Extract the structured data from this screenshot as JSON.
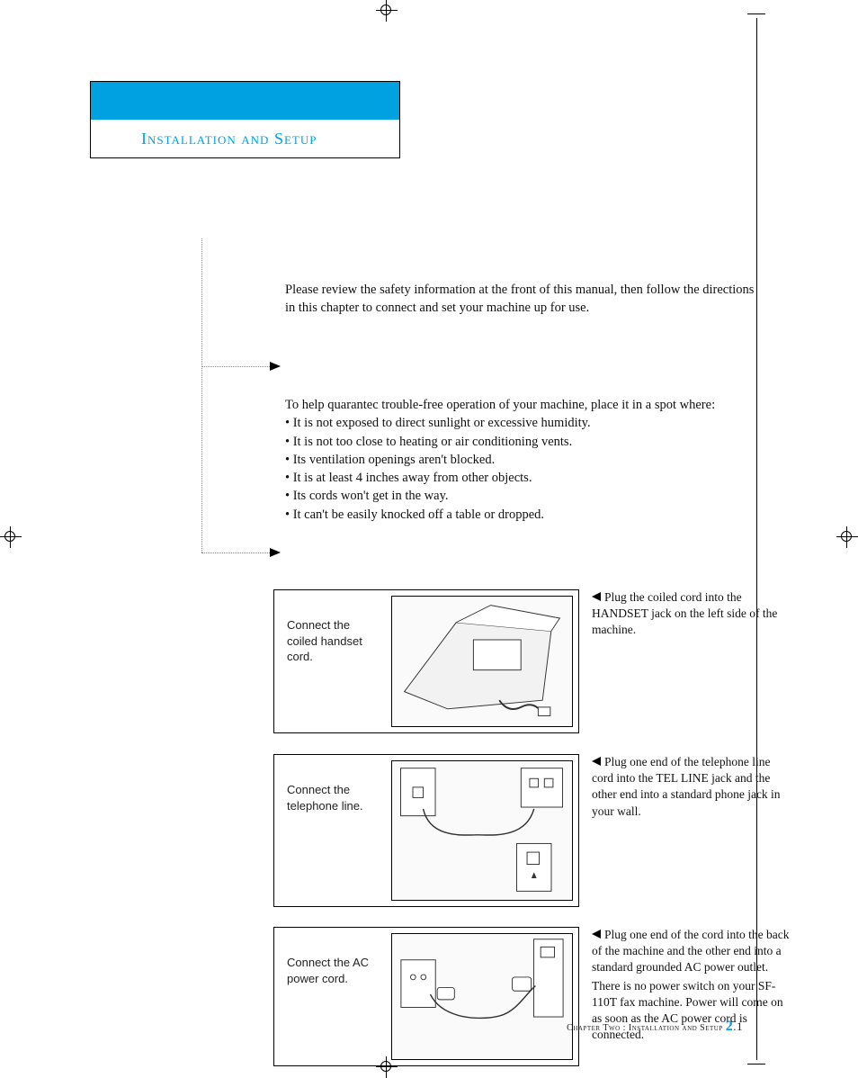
{
  "header": {
    "title": "Installation and Setup"
  },
  "intro": {
    "p1": "Please review the safety information at the front of this manual, then follow the directions in this chapter to connect and set your machine up for use.",
    "p2_lead": "To help quarantec trouble-free operation of your machine, place it in a spot where:",
    "bullets": [
      "It is not exposed to direct sunlight or excessive humidity.",
      "It is not too close to heating or air conditioning vents.",
      "Its ventilation openings aren't blocked.",
      "It is at least 4 inches away from other objects.",
      "Its cords won't get in the way.",
      "It can't be easily knocked off a table or dropped."
    ]
  },
  "steps": [
    {
      "label": "Connect the coiled handset cord.",
      "desc": "Plug the coiled cord into the HANDSET jack on the left side of the machine."
    },
    {
      "label": "Connect the telephone line.",
      "desc": "Plug one end of the telephone line cord into the TEL LINE jack and the other end into a standard phone jack in your wall."
    },
    {
      "label": "Connect the AC power cord.",
      "desc": "Plug one end of the cord into the back of the machine and the other end into a standard grounded AC power outlet.",
      "desc2": "There is no power switch on your SF-110T fax machine. Power will come on as soon as the AC power cord is connected."
    }
  ],
  "footer": {
    "chapter": "Chapter Two : Installation and Setup",
    "page_major": "2",
    "page_minor": ".1"
  }
}
